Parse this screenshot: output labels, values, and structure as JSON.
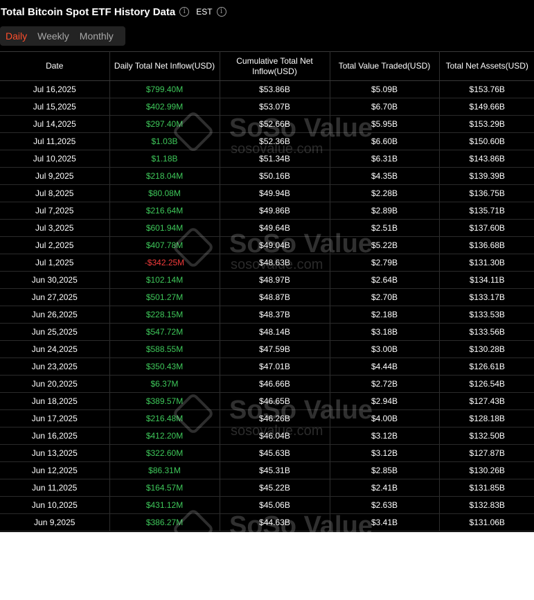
{
  "header": {
    "title": "Total Bitcoin Spot ETF History Data",
    "timezone": "EST"
  },
  "tabs": [
    "Daily",
    "Weekly",
    "Monthly"
  ],
  "active_tab": "Daily",
  "watermark": {
    "name": "SoSo Value",
    "site": "sosovalue.com"
  },
  "colors": {
    "positive": "#3ec85a",
    "negative": "#f23b3b",
    "active_tab": "#ff4f2d",
    "background": "#000000"
  },
  "table": {
    "columns": [
      "Date",
      "Daily Total Net Inflow(USD)",
      "Cumulative Total Net Inflow(USD)",
      "Total Value Traded(USD)",
      "Total Net Assets(USD)"
    ],
    "rows": [
      [
        "Jul 16,2025",
        "$799.40M",
        "$53.86B",
        "$5.09B",
        "$153.76B"
      ],
      [
        "Jul 15,2025",
        "$402.99M",
        "$53.07B",
        "$6.70B",
        "$149.66B"
      ],
      [
        "Jul 14,2025",
        "$297.40M",
        "$52.66B",
        "$5.95B",
        "$153.29B"
      ],
      [
        "Jul 11,2025",
        "$1.03B",
        "$52.36B",
        "$6.60B",
        "$150.60B"
      ],
      [
        "Jul 10,2025",
        "$1.18B",
        "$51.34B",
        "$6.31B",
        "$143.86B"
      ],
      [
        "Jul 9,2025",
        "$218.04M",
        "$50.16B",
        "$4.35B",
        "$139.39B"
      ],
      [
        "Jul 8,2025",
        "$80.08M",
        "$49.94B",
        "$2.28B",
        "$136.75B"
      ],
      [
        "Jul 7,2025",
        "$216.64M",
        "$49.86B",
        "$2.89B",
        "$135.71B"
      ],
      [
        "Jul 3,2025",
        "$601.94M",
        "$49.64B",
        "$2.51B",
        "$137.60B"
      ],
      [
        "Jul 2,2025",
        "$407.78M",
        "$49.04B",
        "$5.22B",
        "$136.68B"
      ],
      [
        "Jul 1,2025",
        "-$342.25M",
        "$48.63B",
        "$2.79B",
        "$131.30B"
      ],
      [
        "Jun 30,2025",
        "$102.14M",
        "$48.97B",
        "$2.64B",
        "$134.11B"
      ],
      [
        "Jun 27,2025",
        "$501.27M",
        "$48.87B",
        "$2.70B",
        "$133.17B"
      ],
      [
        "Jun 26,2025",
        "$228.15M",
        "$48.37B",
        "$2.18B",
        "$133.53B"
      ],
      [
        "Jun 25,2025",
        "$547.72M",
        "$48.14B",
        "$3.18B",
        "$133.56B"
      ],
      [
        "Jun 24,2025",
        "$588.55M",
        "$47.59B",
        "$3.00B",
        "$130.28B"
      ],
      [
        "Jun 23,2025",
        "$350.43M",
        "$47.01B",
        "$4.44B",
        "$126.61B"
      ],
      [
        "Jun 20,2025",
        "$6.37M",
        "$46.66B",
        "$2.72B",
        "$126.54B"
      ],
      [
        "Jun 18,2025",
        "$389.57M",
        "$46.65B",
        "$2.94B",
        "$127.43B"
      ],
      [
        "Jun 17,2025",
        "$216.48M",
        "$46.26B",
        "$4.00B",
        "$128.18B"
      ],
      [
        "Jun 16,2025",
        "$412.20M",
        "$46.04B",
        "$3.12B",
        "$132.50B"
      ],
      [
        "Jun 13,2025",
        "$322.60M",
        "$45.63B",
        "$3.12B",
        "$127.87B"
      ],
      [
        "Jun 12,2025",
        "$86.31M",
        "$45.31B",
        "$2.85B",
        "$130.26B"
      ],
      [
        "Jun 11,2025",
        "$164.57M",
        "$45.22B",
        "$2.41B",
        "$131.85B"
      ],
      [
        "Jun 10,2025",
        "$431.12M",
        "$45.06B",
        "$2.63B",
        "$132.83B"
      ],
      [
        "Jun 9,2025",
        "$386.27M",
        "$44.63B",
        "$3.41B",
        "$131.06B"
      ]
    ]
  }
}
